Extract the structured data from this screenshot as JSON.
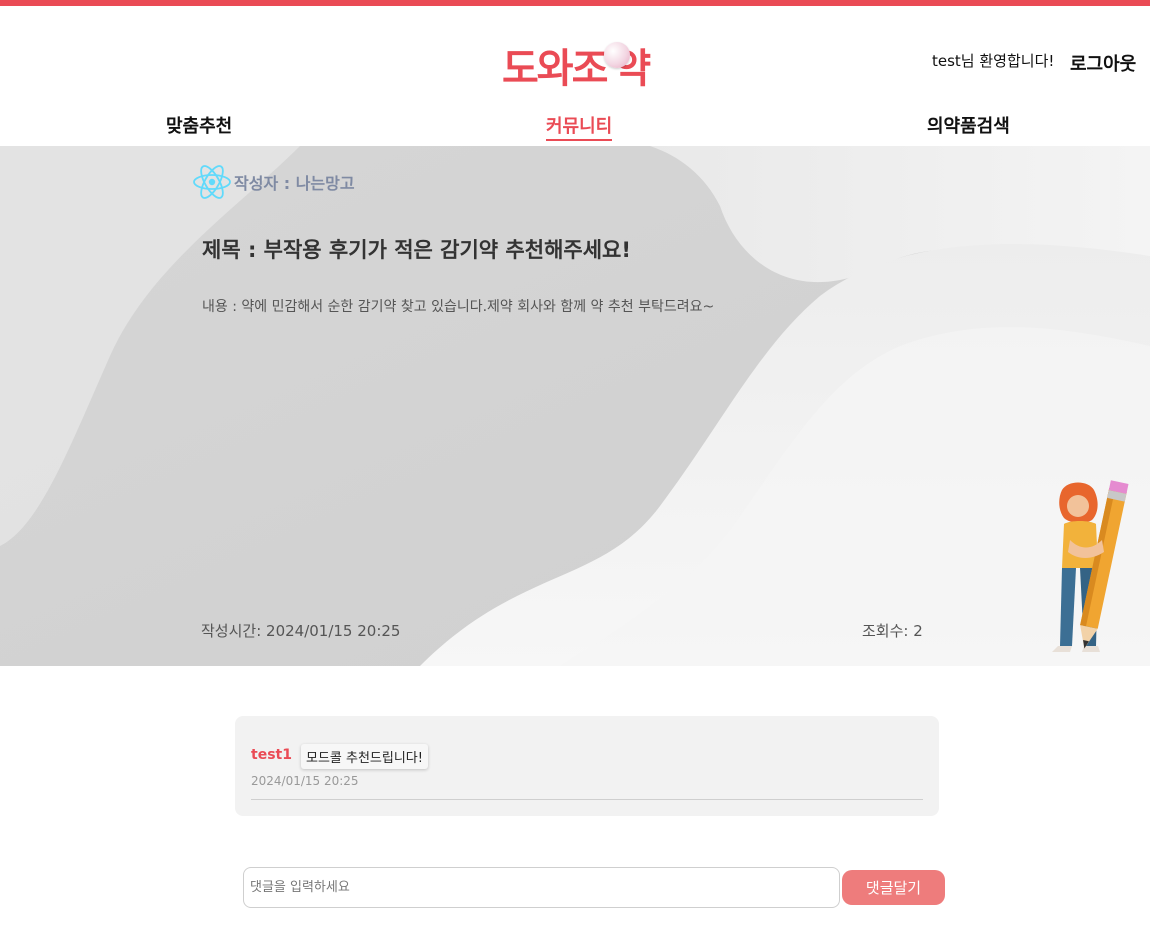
{
  "header": {
    "logo_text": "도와조",
    "logo_text_tail": "약",
    "welcome": "test님 환영합니다!",
    "logout_label": "로그아웃"
  },
  "nav": {
    "recommend": "맞춤추천",
    "community": "커뮤니티",
    "search": "의약품검색"
  },
  "post": {
    "author": "작성자 : 나는망고",
    "title": "제목 : 부작용 후기가 적은 감기약 추천해주세요!",
    "content": "내용 : 약에 민감해서 순한 감기약 찾고 있습니다.제약 회사와 함께 약 추천 부탁드려요~",
    "time": "작성시간: 2024/01/15 20:25",
    "views": "조회수: 2"
  },
  "comments": [
    {
      "user": "test1",
      "text": "모드콜 추천드립니다!",
      "date": "2024/01/15 20:25"
    }
  ],
  "comment_form": {
    "placeholder": "댓글을 입력하세요",
    "value": "",
    "submit_label": "댓글달기"
  },
  "colors": {
    "brand": "#ea4b55",
    "button": "#ee7c7c",
    "author": "#7f8aa3"
  }
}
